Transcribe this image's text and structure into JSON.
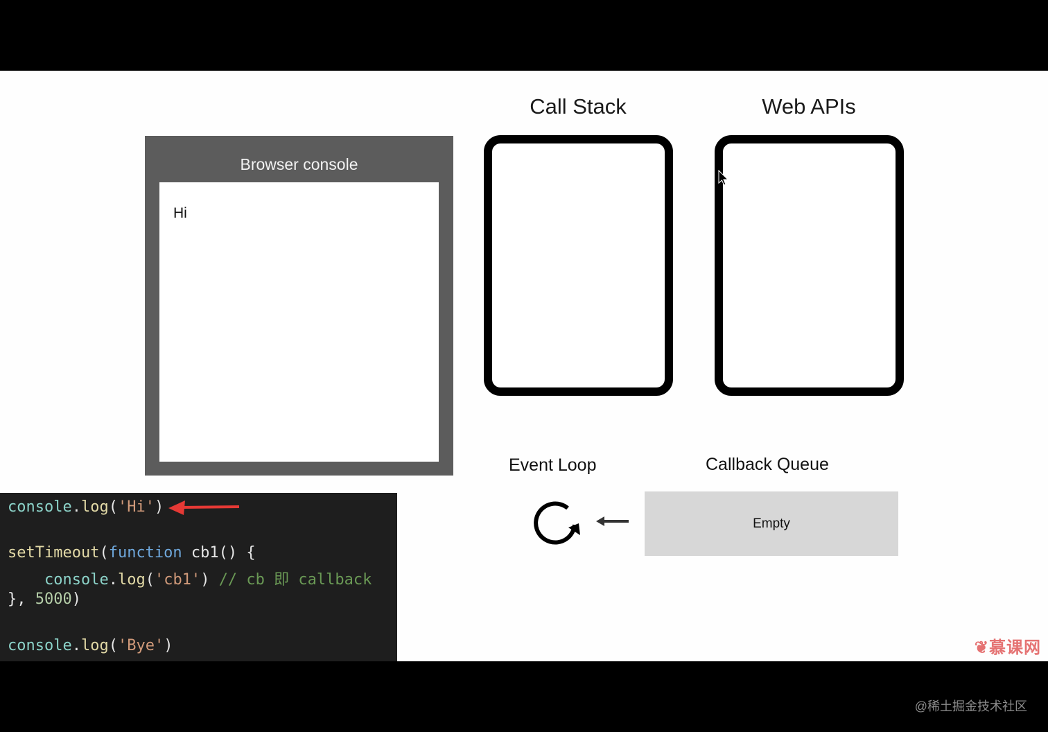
{
  "headings": {
    "call_stack": "Call Stack",
    "web_apis": "Web APIs",
    "event_loop": "Event Loop",
    "callback_queue": "Callback Queue"
  },
  "console": {
    "title": "Browser console",
    "output": [
      "Hi"
    ]
  },
  "queue": {
    "content": "Empty"
  },
  "code": {
    "line1": {
      "obj": "console",
      "dot": ".",
      "fn": "log",
      "open": "(",
      "str": "'Hi'",
      "close": ")"
    },
    "line3": {
      "fn": "setTimeout",
      "open": "(",
      "kw": "function",
      "name": " cb1() {"
    },
    "line4": {
      "indent": "    ",
      "obj": "console",
      "dot": ".",
      "fn": "log",
      "open": "(",
      "str": "'cb1'",
      "close": ") ",
      "comment": "// cb 即 callback"
    },
    "line5": {
      "text": "}, ",
      "num": "5000",
      "close": ")"
    },
    "line7": {
      "obj": "console",
      "dot": ".",
      "fn": "log",
      "open": "(",
      "str": "'Bye'",
      "close": ")"
    }
  },
  "watermark": "慕课网",
  "footer": "@稀土掘金技术社区",
  "colors": {
    "arrow": "#e53935",
    "frame": "#5c5c5c",
    "queue": "#d7d7d7",
    "code_bg": "#1e1e1e"
  },
  "icons": [
    "event-loop-icon",
    "left-arrow-icon",
    "pointer-arrow-icon",
    "cursor-icon",
    "flame-icon"
  ]
}
